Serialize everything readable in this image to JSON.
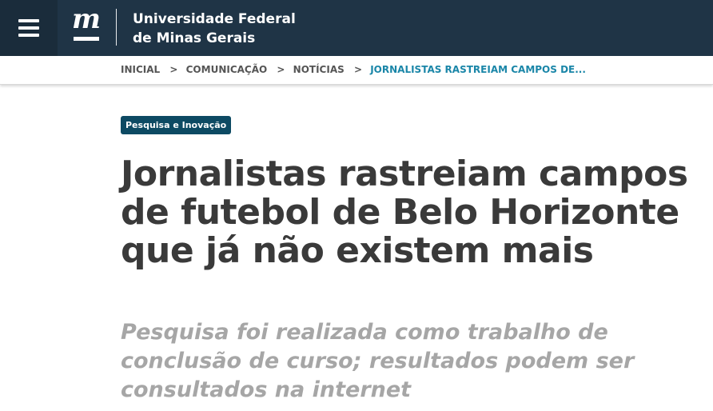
{
  "header": {
    "menu_icon": "hamburger-menu-icon",
    "logo_letter": "m",
    "university_line1": "Universidade Federal",
    "university_line2": "de Minas Gerais",
    "background_color": "#1f3446"
  },
  "breadcrumb": {
    "items": [
      {
        "label": "INICIAL"
      },
      {
        "label": "COMUNICAÇÃO"
      },
      {
        "label": "NOTÍCIAS"
      }
    ],
    "separator": ">",
    "current": "JORNALISTAS RASTREIAM CAMPOS DE...",
    "current_color": "#1a86a8"
  },
  "article": {
    "category": "Pesquisa e Inovação",
    "category_color": "#0d4a63",
    "title": "Jornalistas rastreiam campos de futebol de Belo Horizonte que já não existem mais",
    "subtitle": "Pesquisa foi realizada como trabalho de conclusão de curso; resultados podem ser consultados na internet"
  }
}
